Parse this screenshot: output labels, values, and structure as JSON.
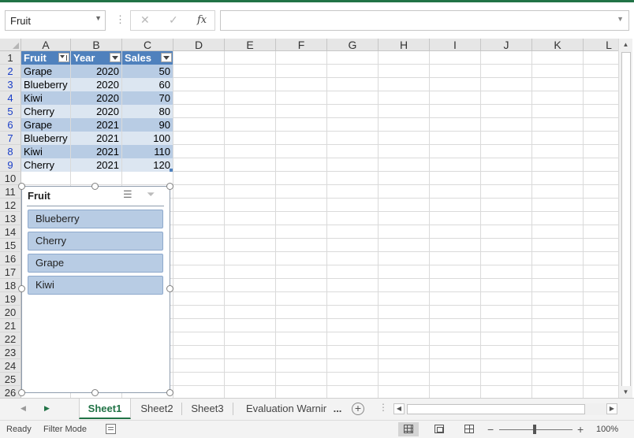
{
  "formula_bar": {
    "name_box": "Fruit",
    "cancel_glyph": "✕",
    "enter_glyph": "✓",
    "function_glyph": "fx",
    "formula": ""
  },
  "columns": [
    "A",
    "B",
    "C",
    "D",
    "E",
    "F",
    "G",
    "H",
    "I",
    "J",
    "K",
    "L"
  ],
  "rows": [
    "1",
    "2",
    "3",
    "4",
    "5",
    "6",
    "7",
    "8",
    "9",
    "10",
    "11",
    "12",
    "13",
    "14",
    "15",
    "16",
    "17",
    "18",
    "19",
    "20",
    "21",
    "22",
    "23",
    "24",
    "25",
    "26"
  ],
  "table": {
    "headers": [
      "Fruit",
      "Year",
      "Sales"
    ],
    "rows": [
      [
        "Grape",
        "2020",
        "50"
      ],
      [
        "Blueberry",
        "2020",
        "60"
      ],
      [
        "Kiwi",
        "2020",
        "70"
      ],
      [
        "Cherry",
        "2020",
        "80"
      ],
      [
        "Grape",
        "2021",
        "90"
      ],
      [
        "Blueberry",
        "2021",
        "100"
      ],
      [
        "Kiwi",
        "2021",
        "110"
      ],
      [
        "Cherry",
        "2021",
        "120"
      ]
    ]
  },
  "slicer": {
    "title": "Fruit",
    "multiselect_icon": "multi-select-icon",
    "clear_filter_icon": "clear-filter-icon",
    "items": [
      "Blueberry",
      "Cherry",
      "Grape",
      "Kiwi"
    ]
  },
  "sheet_tabs": [
    "Sheet1",
    "Sheet2",
    "Sheet3",
    "Evaluation Warnir"
  ],
  "active_sheet": "Sheet1",
  "more_tabs": "...",
  "add_sheet": "+",
  "status": {
    "ready": "Ready",
    "mode": "Filter Mode",
    "zoom_minus": "−",
    "zoom_plus": "+",
    "zoom": "100%"
  },
  "colors": {
    "accent": "#217346",
    "table_header": "#4f81bd",
    "band_dark": "#b8cce4",
    "band_light": "#dce6f1"
  }
}
